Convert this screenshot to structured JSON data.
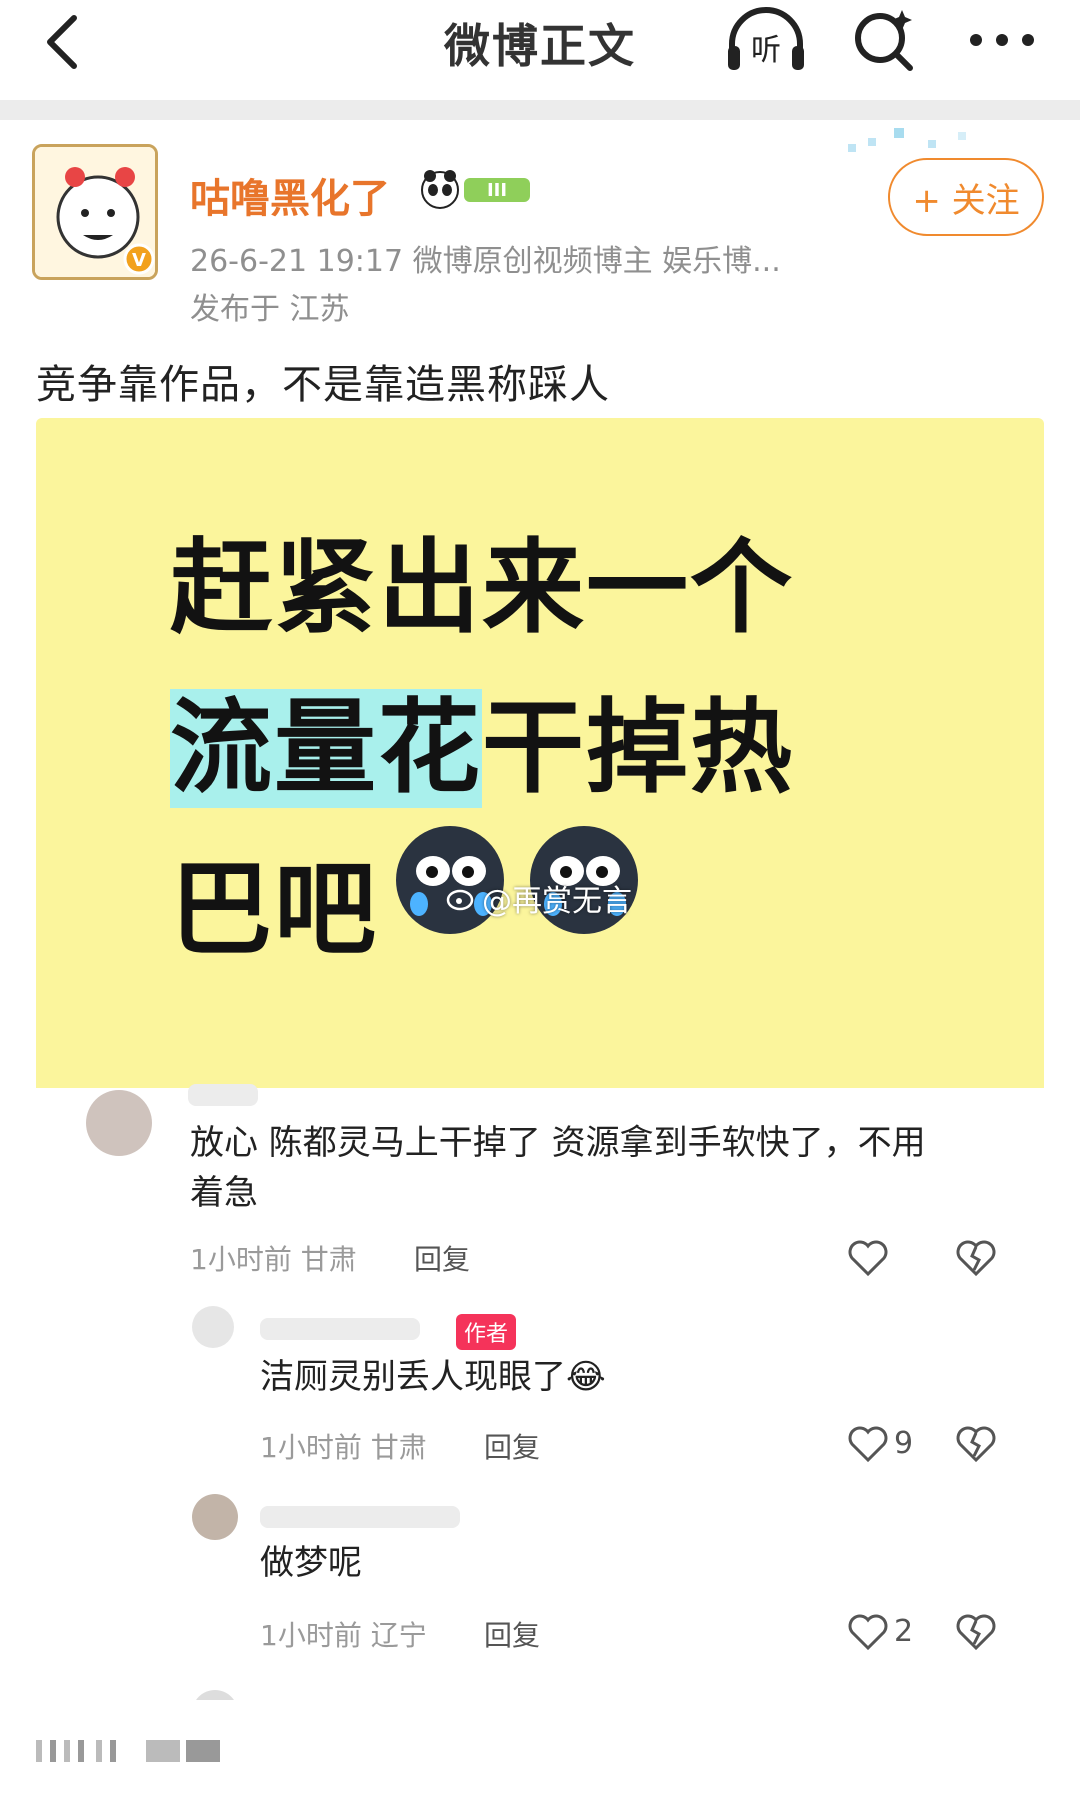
{
  "header": {
    "title": "微博正文",
    "listen_label": "听"
  },
  "post": {
    "author_name": "咕噜黑化了",
    "meta": "26-6-21 19:17   微博原创视频博主 娱乐博...",
    "location": "发布于 江苏",
    "follow_label": "+ 关注",
    "text": "竞争靠作品，不是靠造黑称踩人"
  },
  "image": {
    "meme_line1": "赶紧出来一个",
    "meme_line2_highlight": "流量花",
    "meme_line2_rest": "干掉热",
    "meme_line3": "巴吧",
    "watermark": "@再赏无言",
    "comments": [
      {
        "text": "放心 陈都灵马上干掉了 资源拿到手软快了，不用着急",
        "time": "1小时前",
        "region": "甘肃",
        "reply": "回复",
        "likes": ""
      },
      {
        "author_tag": "作者",
        "text": "洁厕灵别丢人现眼了😂",
        "time": "1小时前",
        "region": "甘肃",
        "reply": "回复",
        "likes": "9"
      },
      {
        "text": "做梦呢",
        "time": "1小时前",
        "region": "辽宁",
        "reply": "回复",
        "likes": "2"
      }
    ]
  },
  "colors": {
    "accent_orange": "#f08a2e",
    "meme_yellow": "#fbf59c",
    "highlight_cyan": "#a9f0ec",
    "author_tag_red": "#f5335a"
  },
  "icons": [
    "back-icon",
    "listen-icon",
    "search-icon",
    "more-icon",
    "like-icon",
    "dislike-icon"
  ]
}
